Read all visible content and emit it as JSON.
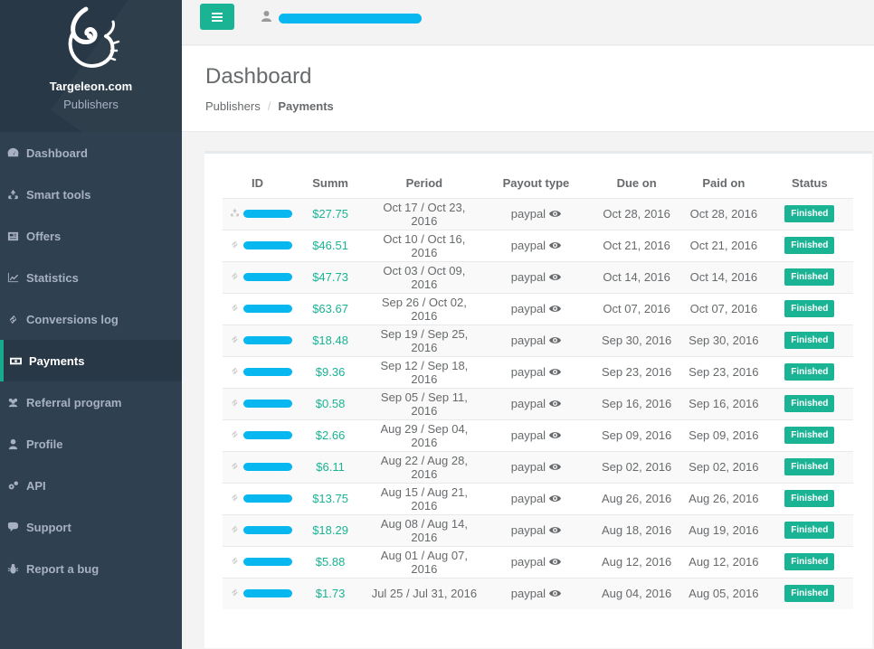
{
  "brand": {
    "title": "Targeleon.com",
    "subtitle": "Publishers"
  },
  "nav": [
    {
      "label": "Dashboard",
      "icon": "dashboard-icon",
      "active": false
    },
    {
      "label": "Smart tools",
      "icon": "recycle-icon",
      "active": false
    },
    {
      "label": "Offers",
      "icon": "newspaper-icon",
      "active": false
    },
    {
      "label": "Statistics",
      "icon": "line-chart-icon",
      "active": false
    },
    {
      "label": "Conversions log",
      "icon": "link-icon",
      "active": false
    },
    {
      "label": "Payments",
      "icon": "money-icon",
      "active": true
    },
    {
      "label": "Referral program",
      "icon": "users-icon",
      "active": false
    },
    {
      "label": "Profile",
      "icon": "user-icon",
      "active": false
    },
    {
      "label": "API",
      "icon": "cogs-icon",
      "active": false
    },
    {
      "label": "Support",
      "icon": "comments-icon",
      "active": false
    },
    {
      "label": "Report a bug",
      "icon": "bug-icon",
      "active": false
    }
  ],
  "header": {
    "title": "Dashboard",
    "breadcrumb": [
      "Publishers",
      "Payments"
    ],
    "separator": "/"
  },
  "table": {
    "columns": [
      "ID",
      "Summ",
      "Period",
      "Payout type",
      "Due on",
      "Paid on",
      "Status"
    ],
    "rows": [
      {
        "summ": "$27.75",
        "period": "Oct 17 / Oct 23, 2016",
        "payout": "paypal",
        "due": "Oct 28, 2016",
        "paid": "Oct 28, 2016",
        "status": "Finished",
        "icon": "recycle-icon"
      },
      {
        "summ": "$46.51",
        "period": "Oct 10 / Oct 16, 2016",
        "payout": "paypal",
        "due": "Oct 21, 2016",
        "paid": "Oct 21, 2016",
        "status": "Finished",
        "icon": "link-icon"
      },
      {
        "summ": "$47.73",
        "period": "Oct 03 / Oct 09, 2016",
        "payout": "paypal",
        "due": "Oct 14, 2016",
        "paid": "Oct 14, 2016",
        "status": "Finished",
        "icon": "link-icon"
      },
      {
        "summ": "$63.67",
        "period": "Sep 26 / Oct 02, 2016",
        "payout": "paypal",
        "due": "Oct 07, 2016",
        "paid": "Oct 07, 2016",
        "status": "Finished",
        "icon": "link-icon"
      },
      {
        "summ": "$18.48",
        "period": "Sep 19 / Sep 25, 2016",
        "payout": "paypal",
        "due": "Sep 30, 2016",
        "paid": "Sep 30, 2016",
        "status": "Finished",
        "icon": "link-icon"
      },
      {
        "summ": "$9.36",
        "period": "Sep 12 / Sep 18, 2016",
        "payout": "paypal",
        "due": "Sep 23, 2016",
        "paid": "Sep 23, 2016",
        "status": "Finished",
        "icon": "link-icon"
      },
      {
        "summ": "$0.58",
        "period": "Sep 05 / Sep 11, 2016",
        "payout": "paypal",
        "due": "Sep 16, 2016",
        "paid": "Sep 16, 2016",
        "status": "Finished",
        "icon": "link-icon"
      },
      {
        "summ": "$2.66",
        "period": "Aug 29 / Sep 04, 2016",
        "payout": "paypal",
        "due": "Sep 09, 2016",
        "paid": "Sep 09, 2016",
        "status": "Finished",
        "icon": "link-icon"
      },
      {
        "summ": "$6.11",
        "period": "Aug 22 / Aug 28, 2016",
        "payout": "paypal",
        "due": "Sep 02, 2016",
        "paid": "Sep 02, 2016",
        "status": "Finished",
        "icon": "link-icon"
      },
      {
        "summ": "$13.75",
        "period": "Aug 15 / Aug 21, 2016",
        "payout": "paypal",
        "due": "Aug 26, 2016",
        "paid": "Aug 26, 2016",
        "status": "Finished",
        "icon": "link-icon"
      },
      {
        "summ": "$18.29",
        "period": "Aug 08 / Aug 14, 2016",
        "payout": "paypal",
        "due": "Aug 18, 2016",
        "paid": "Aug 19, 2016",
        "status": "Finished",
        "icon": "link-icon"
      },
      {
        "summ": "$5.88",
        "period": "Aug 01 / Aug 07, 2016",
        "payout": "paypal",
        "due": "Aug 12, 2016",
        "paid": "Aug 12, 2016",
        "status": "Finished",
        "icon": "link-icon"
      },
      {
        "summ": "$1.73",
        "period": "Jul 25 / Jul 31, 2016",
        "payout": "paypal",
        "due": "Aug 04, 2016",
        "paid": "Aug 05, 2016",
        "status": "Finished",
        "icon": "link-icon"
      }
    ]
  },
  "colors": {
    "accent": "#1ab394",
    "sidebar": "#2f4050",
    "sidebar_dark": "#293846",
    "redaction": "#08b6f0"
  }
}
